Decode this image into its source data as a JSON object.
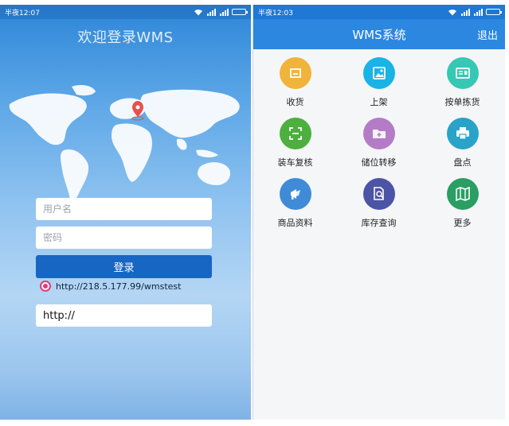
{
  "login_screen": {
    "status": {
      "time": "半夜12:07"
    },
    "title": "欢迎登录WMS",
    "username_placeholder": "用户名",
    "password_placeholder": "密码",
    "login_button": "登录",
    "server_url": "http://218.5.177.99/wmstest",
    "url_input_value": "http://"
  },
  "main_screen": {
    "status": {
      "time": "半夜12:03"
    },
    "title": "WMS系统",
    "logout_label": "退出",
    "menu": [
      {
        "label": "收货",
        "icon": "receive-icon",
        "color": "#f0b43a"
      },
      {
        "label": "上架",
        "icon": "shelve-icon",
        "color": "#19b3e6"
      },
      {
        "label": "按单拣货",
        "icon": "pick-by-order-icon",
        "color": "#36c8b4"
      },
      {
        "label": "装车复核",
        "icon": "scan-check-icon",
        "color": "#4caf3e"
      },
      {
        "label": "储位转移",
        "icon": "folder-transfer-icon",
        "color": "#b47cc6"
      },
      {
        "label": "盘点",
        "icon": "printer-icon",
        "color": "#29a3c8"
      },
      {
        "label": "商品资料",
        "icon": "megaphone-icon",
        "color": "#3f8bd8"
      },
      {
        "label": "库存查询",
        "icon": "document-search-icon",
        "color": "#4c54a6"
      },
      {
        "label": "更多",
        "icon": "map-icon",
        "color": "#2a9e63"
      }
    ]
  }
}
